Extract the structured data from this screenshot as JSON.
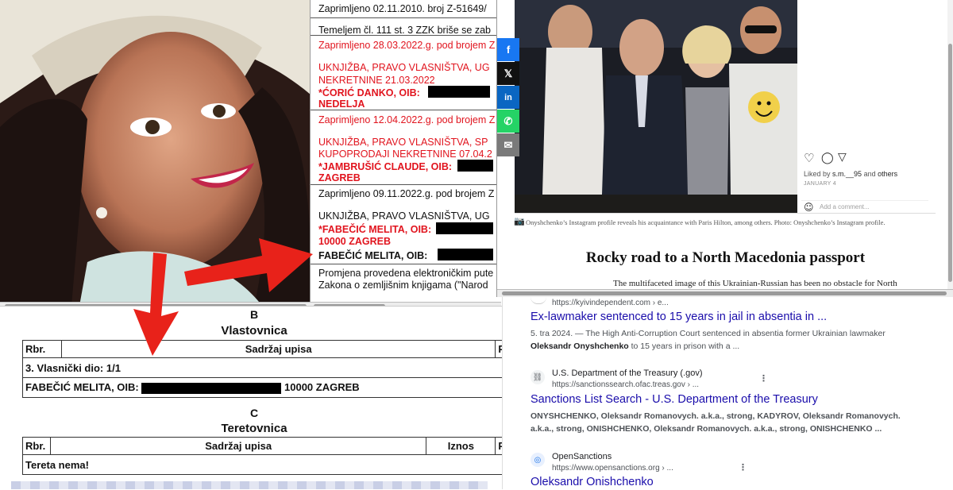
{
  "registry": {
    "section_b": {
      "letter": "B",
      "title": "Vlastovnica",
      "col_rbr": "Rbr.",
      "col_sadrzaj": "Sadržaj upisa",
      "col_p": "P",
      "share_row": "3. Vlasnički dio: 1/1",
      "owner_name": "FABEČIĆ MELITA, OIB:",
      "owner_city": "10000 ZAGREB"
    },
    "section_c": {
      "letter": "C",
      "title": "Teretovnica",
      "col_rbr": "Rbr.",
      "col_sadrzaj": "Sadržaj upisa",
      "col_iznos": "Iznos",
      "col_p": "P",
      "empty_row": "Tereta nema!"
    }
  },
  "doc": {
    "lines": [
      "Zaprimljeno 02.11.2010. broj Z-51649/",
      "Temeljem čl. 111 st. 3 ZZK briše se zab",
      "Zaprimljeno 28.03.2022.g. pod brojem Z",
      "UKNJIŽBA, PRAVO VLASNIŠTVA, UG",
      "NEKRETNINE 21.03.2022",
      "*ĆORIĆ DANKO, OIB:",
      "NEDELJA",
      "Zaprimljeno 12.04.2022.g. pod brojem Z",
      "UKNJIŽBA, PRAVO VLASNIŠTVA, SP",
      "KUPOPRODAJI NEKRETNINE 07.04.2",
      "*JAMBRUŠIĆ CLAUDE, OIB:",
      "ZAGREB",
      "Zaprimljeno 09.11.2022.g. pod brojem Z",
      "UKNJIŽBA, PRAVO VLASNIŠTVA, UG",
      "*FABEČIĆ MELITA, OIB:",
      "10000 ZAGREB",
      "FABEČIĆ MELITA, OIB:",
      "Promjena provedena elektroničkim pute",
      "Zakona o zemljišnim knjigama (\"Narod"
    ]
  },
  "share": {
    "facebook": "f",
    "x": "𝕏",
    "linkedin": "in",
    "whatsapp": "✆",
    "email": "✉"
  },
  "article": {
    "liked_by_prefix": "Liked by ",
    "liked_by_user": "s.m.__95",
    "liked_by_mid": " and ",
    "liked_by_others": "others",
    "post_date": "JANUARY 4",
    "comment_placeholder": "Add a comment...",
    "caption": "Onyshchenko’s Instagram profile reveals his acquaintance with Paris Hilton, among others. Photo: Onyshchenko’s Instagram profile.",
    "heading": "Rocky road to a North Macedonia passport",
    "lead": "The multifaceted image of this Ukrainian-Russian has been no obstacle for North"
  },
  "search": {
    "results": [
      {
        "url": "https://kyivindependent.com › e...",
        "title": "Ex-lawmaker sentenced to 15 years in jail in absentia in ...",
        "snippet1": "5. tra 2024. — The High Anti-Corruption Court sentenced in absentia former Ukrainian lawmaker",
        "snippet2_b": "Oleksandr Onyshchenko",
        "snippet2": " to 15 years in prison with a ..."
      },
      {
        "source": "U.S. Department of the Treasury (.gov)",
        "url": "https://sanctionssearch.ofac.treas.gov › ...",
        "title": "Sanctions List Search - U.S. Department of the Treasury",
        "snippet1": "ONYSHCHENKO, Oleksandr Romanovych. a.k.a., strong, KADYROV, Oleksandr Romanovych.",
        "snippet2": "a.k.a., strong, ONISHCHENKO, Oleksandr Romanovych. a.k.a., strong, ONISHCHENKO ..."
      },
      {
        "source": "OpenSanctions",
        "url": "https://www.opensanctions.org › ...",
        "title": "Oleksandr Onishchenko"
      }
    ]
  },
  "colors": {
    "red": "#e1141e",
    "link": "#1a0dab",
    "arrow": "#e8221a"
  }
}
